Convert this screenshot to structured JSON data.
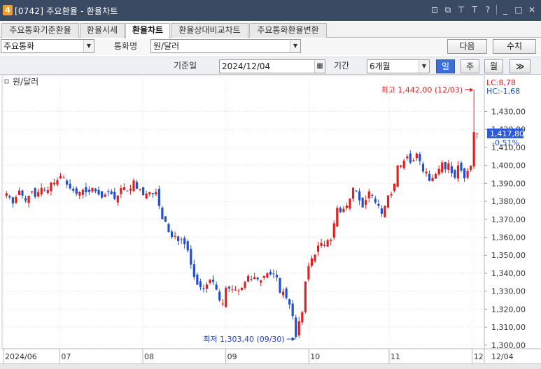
{
  "window": {
    "badge": "4",
    "title": "[0742] 주요환율 - 환율차트",
    "icons": [
      "window-icon",
      "copy-window-icon",
      "pin-icon",
      "font-icon",
      "help-icon",
      "minimize-icon",
      "maximize-icon",
      "close-icon"
    ]
  },
  "tabs": [
    {
      "label": "주요통화기준환율",
      "active": false
    },
    {
      "label": "환율시세",
      "active": false
    },
    {
      "label": "환율차트",
      "active": true
    },
    {
      "label": "환율상대비교차트",
      "active": false
    },
    {
      "label": "주요통화환율변환",
      "active": false
    }
  ],
  "toolbar": {
    "category_value": "주요통화",
    "currency_label": "통화명",
    "currency_value": "원/달러",
    "next_label": "다음",
    "value_label": "수치",
    "base_date_label": "기준일",
    "base_date_value": "2024/12/04",
    "period_label": "기간",
    "period_value": "6개월",
    "interval_buttons": [
      {
        "label": "일",
        "active": true
      },
      {
        "label": "주",
        "active": false
      },
      {
        "label": "월",
        "active": false
      }
    ],
    "more_label": "≫"
  },
  "chart_data": {
    "type": "candlestick",
    "series_label": "원/달러",
    "y_range": [
      1298,
      1450
    ],
    "y_ticks": [
      "1,430,00",
      "1,420,00",
      "1,410,00",
      "1,400,00",
      "1,390,00",
      "1,380,00",
      "1,370,00",
      "1,360,00",
      "1,350,00",
      "1,340,00",
      "1,330,00",
      "1,320,00",
      "1,310,00",
      "1,300,00"
    ],
    "y_tick_values": [
      1430,
      1420,
      1410,
      1400,
      1390,
      1380,
      1370,
      1360,
      1350,
      1340,
      1330,
      1320,
      1310,
      1300
    ],
    "x_labels": [
      "2024/06",
      "07",
      "08",
      "09",
      "10",
      "11",
      "12"
    ],
    "x_label_days": [
      0,
      21,
      52,
      83,
      114,
      144,
      175
    ],
    "x_end_label": "12/04",
    "x_day_range": [
      0,
      179
    ],
    "lc_label": "LC:8,78",
    "hc_label": "HC:-1,68",
    "current_value": "1,417,80",
    "current_value_num": 1417.8,
    "current_change": "-0,51%",
    "max_label": "최고 1,442,00 (12/03)",
    "max_value": 1442.0,
    "min_label": "최저 1,303,40 (09/30)",
    "min_value": 1303.4,
    "closes": [
      1384.5,
      1382.2,
      1378.8,
      1382.4,
      1386.0,
      1383.2,
      1380.4,
      1383.1,
      1385.5,
      1382.5,
      1385.2,
      1387.5,
      1386.1,
      1386.2,
      1390.5,
      1390.3,
      1391.7,
      1394.1,
      1393.3,
      1389.2,
      1387.2,
      1385.9,
      1384.1,
      1385.1,
      1386.4,
      1385.0,
      1385.2,
      1387.5,
      1385.6,
      1383.8,
      1382.1,
      1383.7,
      1385.2,
      1384.0,
      1381.3,
      1383.2,
      1387.4,
      1387.8,
      1385.8,
      1387.0,
      1391.6,
      1387.0,
      1386.6,
      1383.5,
      1384.3,
      1385.0,
      1384.0,
      1385.2,
      1377.4,
      1370.1,
      1368.6,
      1362.8,
      1360.1,
      1360.8,
      1357.9,
      1358.9,
      1356.2,
      1352.7,
      1344.8,
      1337.9,
      1333.6,
      1332.2,
      1331.3,
      1333.7,
      1336.5,
      1335.1,
      1330.9,
      1324.9,
      1323.1,
      1331.9,
      1331.5,
      1331.1,
      1330.8,
      1330.4,
      1331.9,
      1335.2,
      1338.5,
      1336.6,
      1337.9,
      1336.6,
      1336.0,
      1338.5,
      1339.9,
      1339.3,
      1339.6,
      1337.7,
      1329.2,
      1329.7,
      1326.2,
      1322.6,
      1316.2,
      1304.6,
      1313.3,
      1318.3,
      1335.3,
      1344.0,
      1348.3,
      1350.3,
      1355.4,
      1356.9,
      1355.8,
      1358.5,
      1358.6,
      1367.8,
      1376.4,
      1374.0,
      1375.9,
      1377.6,
      1381.6,
      1387.6,
      1385.8,
      1380.5,
      1376.6,
      1380.7,
      1385.5,
      1383.1,
      1379.4,
      1377.5,
      1373.1,
      1377.3,
      1383.3,
      1384.0,
      1389.8,
      1399.9,
      1400.0,
      1402.7,
      1405.0,
      1401.5,
      1402.9,
      1406.6,
      1402.4,
      1396.6,
      1396.5,
      1391.4,
      1393.0,
      1395.2,
      1398.1,
      1401.6,
      1397.8,
      1401.2,
      1395.7,
      1393.1,
      1400.0,
      1397.1,
      1392.8,
      1397.0,
      1399.8,
      1418.5,
      1417.8
    ]
  },
  "status": {
    "icons": [
      "first-page-icon",
      "prev-page-icon",
      "stop-icon",
      "next-page-icon"
    ]
  }
}
